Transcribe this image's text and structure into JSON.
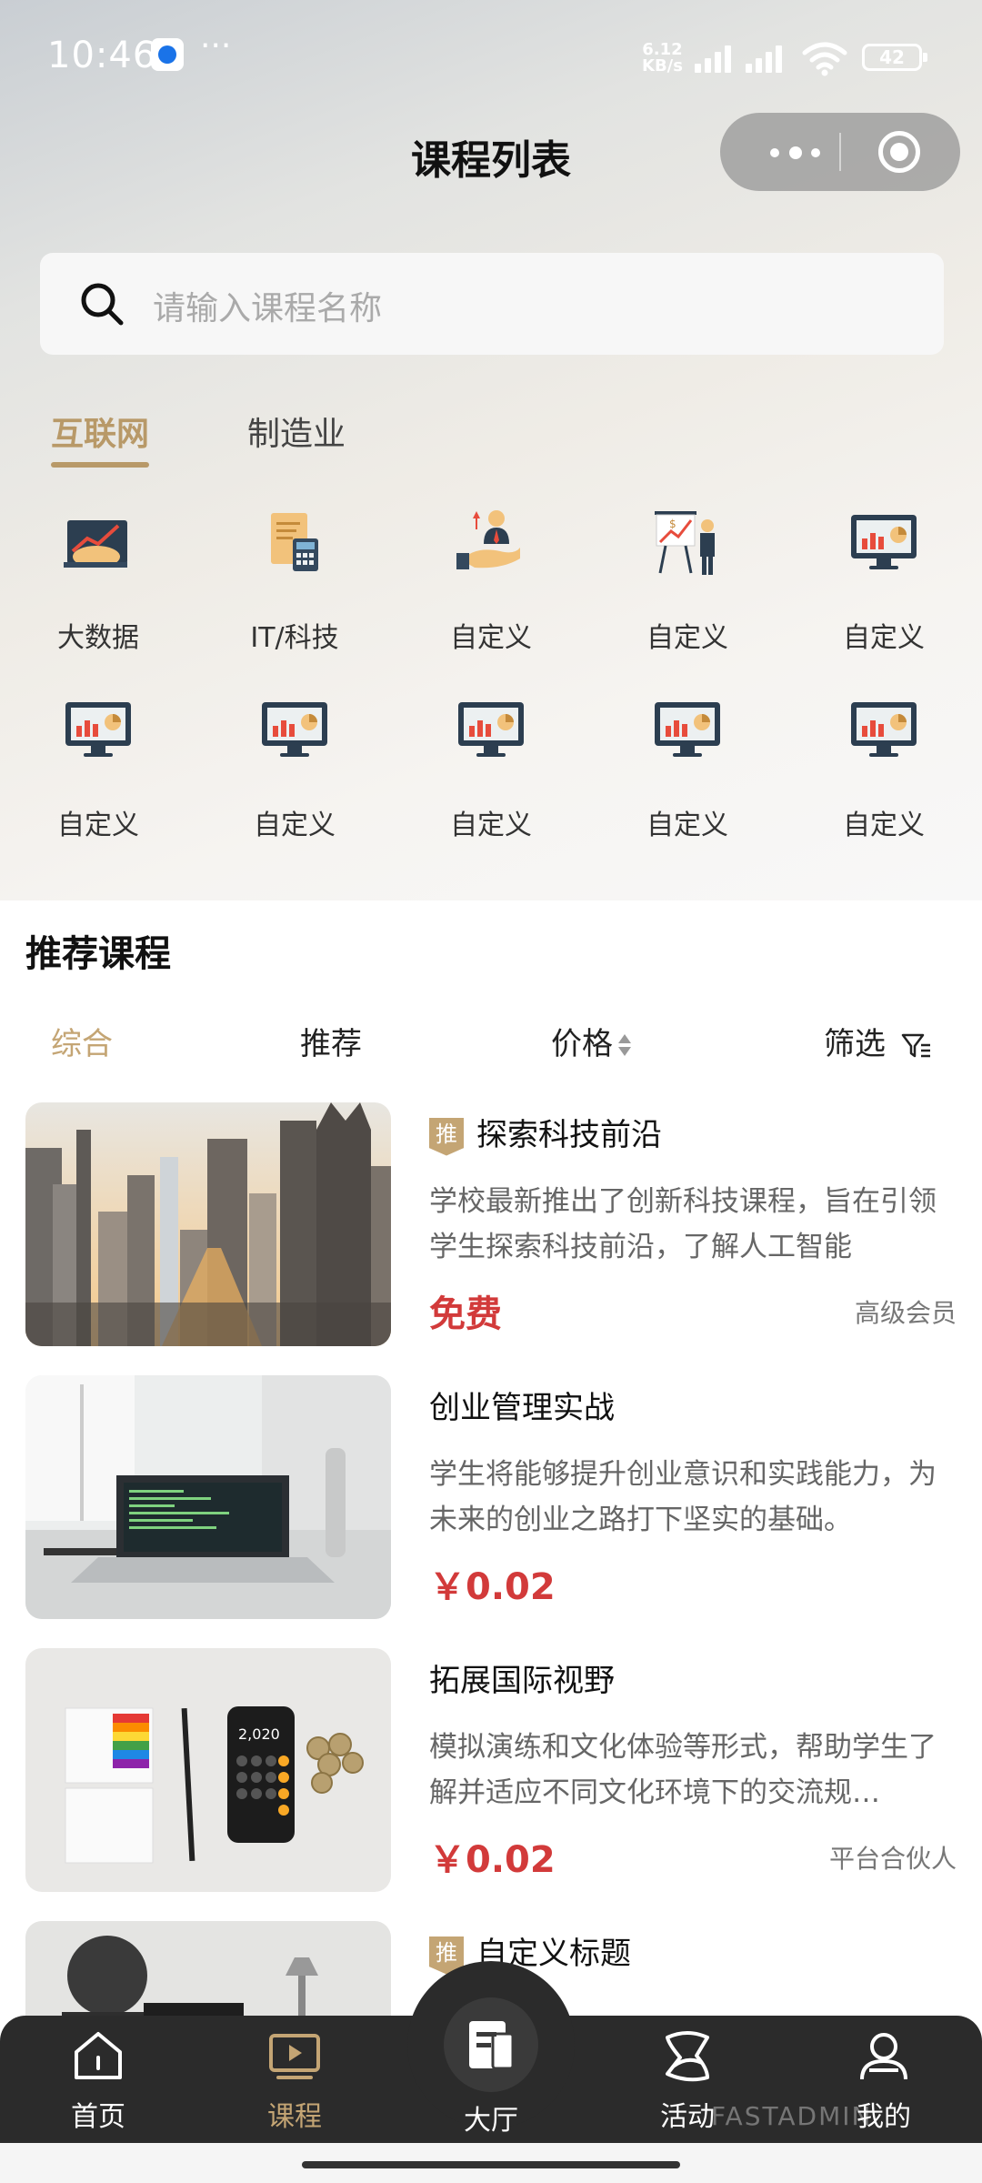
{
  "status_bar": {
    "time": "10:46",
    "dots": "···",
    "net_speed_value": "6.12",
    "net_speed_unit": "KB/s",
    "battery": "42"
  },
  "header": {
    "title": "课程列表"
  },
  "search": {
    "placeholder": "请输入课程名称"
  },
  "category_tabs": [
    {
      "label": "互联网",
      "active": true
    },
    {
      "label": "制造业",
      "active": false
    }
  ],
  "category_grid": [
    {
      "label": "大数据",
      "icon": "handshake-chart-icon"
    },
    {
      "label": "IT/科技",
      "icon": "calculator-document-icon"
    },
    {
      "label": "自定义",
      "icon": "businessman-hand-icon"
    },
    {
      "label": "自定义",
      "icon": "presentation-board-icon"
    },
    {
      "label": "自定义",
      "icon": "monitor-chart-icon"
    },
    {
      "label": "自定义",
      "icon": "monitor-chart-icon"
    },
    {
      "label": "自定义",
      "icon": "monitor-chart-icon"
    },
    {
      "label": "自定义",
      "icon": "monitor-chart-icon"
    },
    {
      "label": "自定义",
      "icon": "monitor-chart-icon"
    },
    {
      "label": "自定义",
      "icon": "monitor-chart-icon"
    }
  ],
  "recommend": {
    "title": "推荐课程",
    "sort_tabs": {
      "comprehensive": "综合",
      "recommended": "推荐",
      "price": "价格",
      "filter": "筛选"
    },
    "courses": [
      {
        "tag": "推",
        "title": "探索科技前沿",
        "desc": "学校最新推出了创新科技课程，旨在引领学生探索科技前沿，了解人工智能",
        "price": "免费",
        "level": "高级会员"
      },
      {
        "tag": "",
        "title": "创业管理实战",
        "desc": "学生将能够提升创业意识和实践能力，为未来的创业之路打下坚实的基础。",
        "price": "￥0.02",
        "level": ""
      },
      {
        "tag": "",
        "title": "拓展国际视野",
        "desc": "模拟演练和文化体验等形式，帮助学生了解并适应不同文化环境下的交流规…",
        "price": "￥0.02",
        "level": "平台合伙人"
      },
      {
        "tag": "推",
        "title": "自定义标题",
        "desc": "",
        "price": "",
        "level": ""
      }
    ]
  },
  "tabbar": {
    "home": "首页",
    "courses": "课程",
    "hall": "大厅",
    "activity": "活动",
    "mine": "我的",
    "watermark": "FASTADMIN"
  },
  "colors": {
    "accent": "#c4a574",
    "price": "#d23a3a",
    "tabbar": "#2b2b2b"
  }
}
